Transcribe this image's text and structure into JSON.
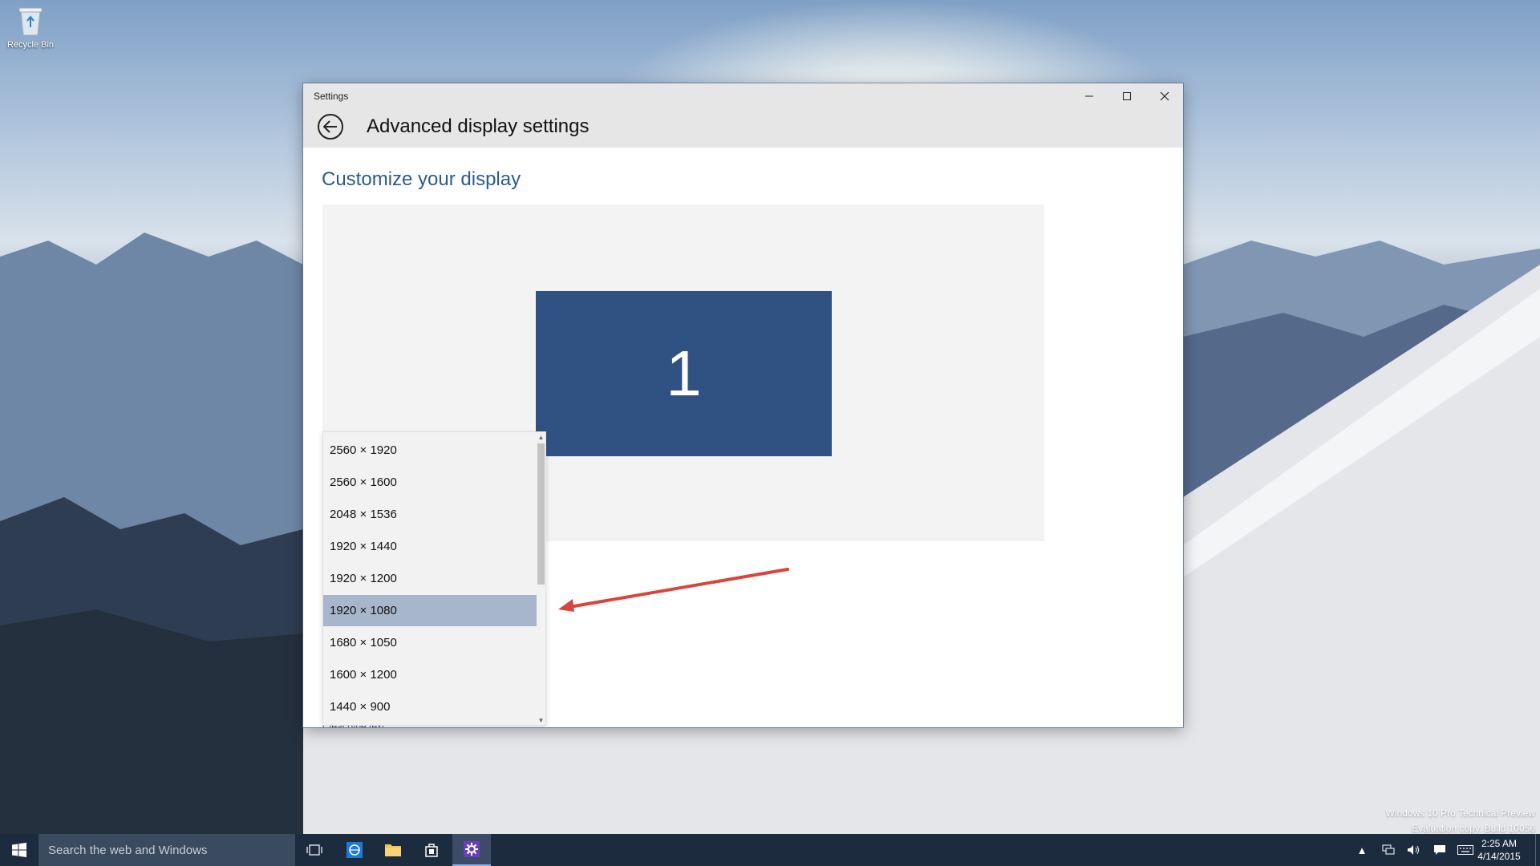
{
  "desktop": {
    "recycle_bin_label": "Recycle Bin"
  },
  "window": {
    "title": "Settings",
    "header_title": "Advanced display settings",
    "section_title": "Customize your display",
    "monitor_number": "1",
    "resolutions": [
      "2560 × 1920",
      "2560 × 1600",
      "2048 × 1536",
      "1920 × 1440",
      "1920 × 1200",
      "1920 × 1080",
      "1680 × 1050",
      "1600 × 1200",
      "1440 × 900"
    ],
    "selected_resolution": "1920 × 1080",
    "partial_link": "ClearType text"
  },
  "watermark": {
    "line1": "Windows 10 Pro Technical Preview",
    "line2": "Evaluation copy. Build 10056"
  },
  "taskbar": {
    "search_placeholder": "Search the web and Windows",
    "time": "2:25 AM",
    "date": "4/14/2015",
    "icons": [
      "start-icon",
      "task-view-icon",
      "ie-icon",
      "file-explorer-icon",
      "store-icon",
      "settings-icon"
    ]
  },
  "colors": {
    "accent": "#2f5283",
    "link": "#2c5a8e",
    "selected_item": "#a8b6cb",
    "taskbar": "#1d2b3f",
    "arrow": "#d9453c"
  }
}
